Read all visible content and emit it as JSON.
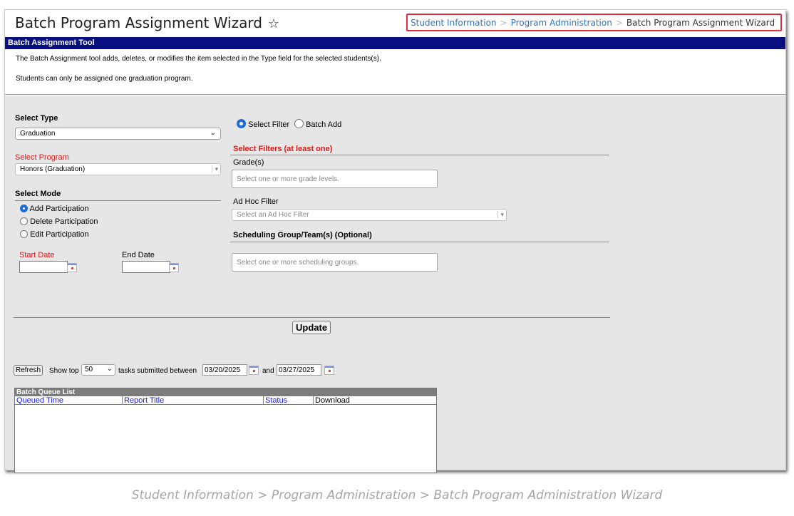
{
  "header": {
    "title": "Batch Program Assignment Wizard",
    "star_glyph": "☆",
    "breadcrumb": {
      "item1": "Student Information",
      "item2": "Program Administration",
      "current": "Batch Program Assignment Wizard",
      "separator": ">"
    }
  },
  "section_title": "Batch Assignment Tool",
  "info": {
    "line1": "The Batch Assignment tool adds, deletes, or modifies the item selected in the Type field for the selected students(s).",
    "line2": "Students can only be assigned one graduation program."
  },
  "form": {
    "select_type_label": "Select Type",
    "select_type_value": "Graduation",
    "select_program_label": "Select Program",
    "select_program_value": "Honors (Graduation)",
    "select_mode_label": "Select Mode",
    "mode_options": [
      "Add Participation",
      "Delete Participation",
      "Edit Participation"
    ],
    "mode_selected": "Add Participation",
    "start_date_label": "Start Date",
    "end_date_label": "End Date",
    "start_date_value": "",
    "end_date_value": ""
  },
  "filter": {
    "option_select_filter": "Select Filter",
    "option_batch_add": "Batch Add",
    "selected": "Select Filter",
    "heading": "Select Filters (at least one)",
    "grades_label": "Grade(s)",
    "grades_placeholder": "Select one or more grade levels.",
    "adhoc_label": "Ad Hoc Filter",
    "adhoc_placeholder": "Select an Ad Hoc Filter",
    "sched_heading": "Scheduling Group/Team(s) (Optional)",
    "sched_placeholder": "Select one or more scheduling groups."
  },
  "update_label": "Update",
  "queue_controls": {
    "refresh_label": "Refresh",
    "show_top_label": "Show top",
    "top_value": "50",
    "between_label": "tasks submitted between",
    "date_from": "03/20/2025",
    "and_label": "and",
    "date_to": "03/27/2025"
  },
  "queue": {
    "title": "Batch Queue List",
    "columns": [
      "Queued Time",
      "Report Title",
      "Status",
      "Download"
    ]
  },
  "caption": "Student Information > Program Administration > Batch Program Administration Wizard",
  "colors": {
    "section_bar": "#0a0f80",
    "required_label": "#e01818",
    "breadcrumb_link": "#2f73c5",
    "breadcrumb_highlight": "#e03040",
    "link": "#1a1adf"
  }
}
